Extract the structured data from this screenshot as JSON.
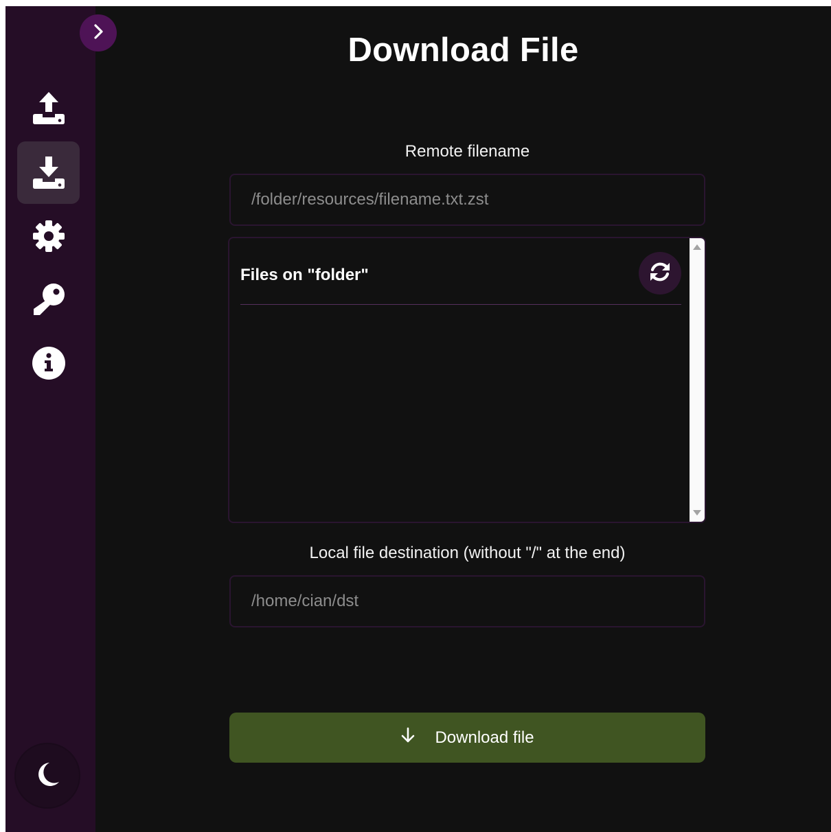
{
  "page": {
    "title": "Download File"
  },
  "sidebar": {
    "items": [
      {
        "icon": "upload-icon",
        "active": false
      },
      {
        "icon": "download-icon",
        "active": true
      },
      {
        "icon": "gear-icon",
        "active": false
      },
      {
        "icon": "key-icon",
        "active": false
      },
      {
        "icon": "info-icon",
        "active": false
      }
    ],
    "expand_icon": "chevron-right-icon",
    "theme_icon": "moon-icon"
  },
  "remote": {
    "label": "Remote filename",
    "placeholder": "/folder/resources/filename.txt.zst"
  },
  "files": {
    "title": "Files on \"folder\"",
    "refresh_icon": "refresh-icon",
    "items": []
  },
  "local": {
    "label": "Local file destination (without \"/\" at the end)",
    "placeholder": "/home/cian/dst"
  },
  "download_button": {
    "label": "Download file",
    "icon": "arrow-down-icon"
  },
  "colors": {
    "background": "#111111",
    "sidebar": "#250d26",
    "accent": "#4e1356",
    "button": "#405522"
  }
}
